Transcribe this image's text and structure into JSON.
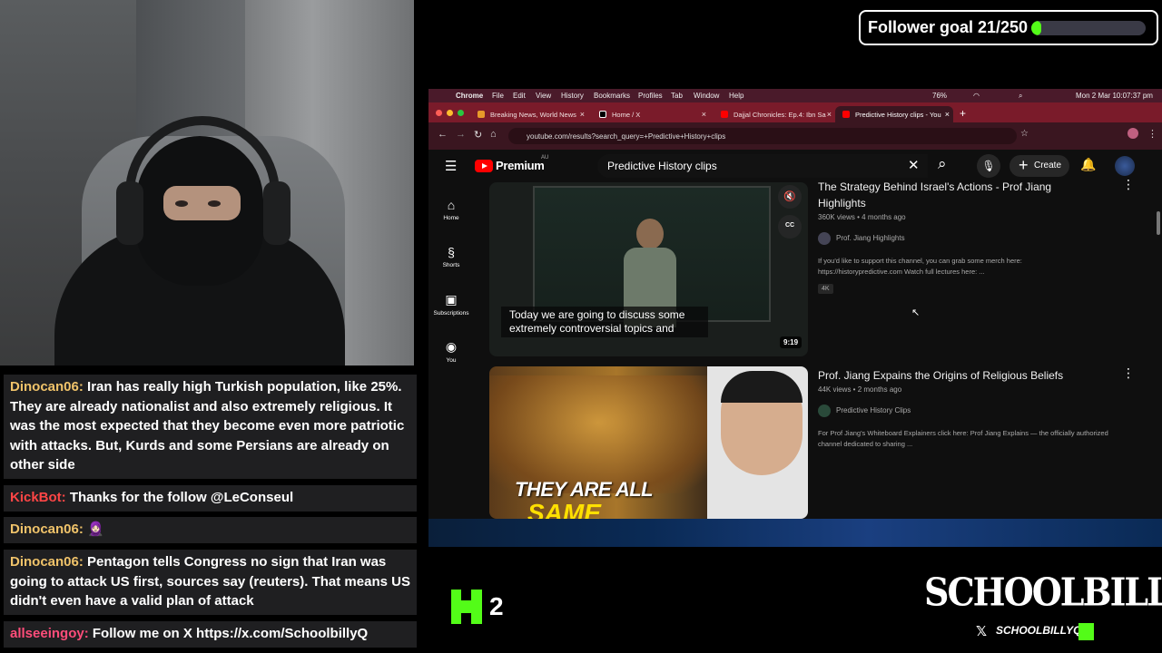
{
  "follower_goal": {
    "label": "Follower goal 21/250",
    "current": 21,
    "target": 250
  },
  "chat": [
    {
      "user": "Dinocan06:",
      "text": "Iran has really high Turkish population, like 25%. They are already nationalist and also extremely religious. It was the most expected that they become even more patriotic with attacks. But, Kurds and some Persians are already on other side"
    },
    {
      "user": "KickBot:",
      "text": "Thanks for the follow @LeConseul"
    },
    {
      "user": "Dinocan06:",
      "text": "🧕🏻"
    },
    {
      "user": "Dinocan06:",
      "text": "Pentagon tells Congress no sign that Iran was going to attack US first, sources say (reuters). That means US didn't even have a valid plan of attack"
    },
    {
      "user": "allseeingoy:",
      "text": "Follow me on X https://x.com/SchoolbillyQ"
    }
  ],
  "macos_menu": {
    "app": "Chrome",
    "items": [
      "File",
      "Edit",
      "View",
      "History",
      "Bookmarks",
      "Profiles",
      "Tab",
      "Window",
      "Help"
    ],
    "battery": "76%",
    "datetime": "Mon 2 Mar  10:07:37 pm"
  },
  "browser": {
    "tabs": [
      {
        "title": "Breaking News, World News"
      },
      {
        "title": "Home / X"
      },
      {
        "title": "Dajjal Chronicles: Ep.4: Ibn Sa"
      },
      {
        "title": "Predictive History clips - You"
      }
    ],
    "url": "youtube.com/results?search_query=+Predictive+History+clips"
  },
  "youtube": {
    "logo": "Premium",
    "region": "AU",
    "search_query": "Predictive History clips",
    "create_label": "Create",
    "sidebar": [
      {
        "label": "Home",
        "icon": "⌂"
      },
      {
        "label": "Shorts",
        "icon": "§"
      },
      {
        "label": "Subscriptions",
        "icon": "▣"
      },
      {
        "label": "You",
        "icon": "◉"
      }
    ],
    "videos": [
      {
        "title": "The Strategy Behind Israel's Actions - Prof Jiang Highlights",
        "meta": "360K views • 4 months ago",
        "channel": "Prof. Jiang Highlights",
        "description": "If you'd like to support this channel, you can grab some merch here: https://historypredictive.com Watch full lectures here: ...",
        "badge": "4K",
        "duration": "9:19",
        "caption": "Today we are going to discuss some extremely controversial topics and"
      },
      {
        "title": "Prof. Jiang Expains the Origins of Religious Beliefs",
        "meta": "44K views • 2 months ago",
        "channel": "Predictive History Clips",
        "description": "For Prof Jiang's Whiteboard Explainers click here: Prof Jiang Explains — the officially authorized channel dedicated to sharing ...",
        "thumb_text_1": "THEY ARE ALL",
        "thumb_text_2": "SAME"
      }
    ]
  },
  "overlay": {
    "kick_count": "2",
    "brand": "SCHOOLBILLYQ",
    "brand_sub": "SCHOOLBILLYQ"
  }
}
